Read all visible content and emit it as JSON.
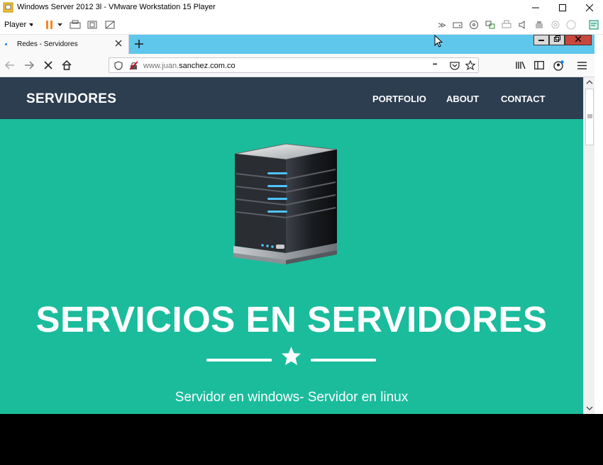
{
  "vm": {
    "window_title": "Windows Server 2012 3l - VMware Workstation 15 Player",
    "player_menu": "Player"
  },
  "browser": {
    "tab_title": "Redes - Servidores",
    "url_prefix": "www.juan.",
    "url_domain": "sanchez.com.co",
    "menu_dots": "•••"
  },
  "site": {
    "brand": "SERVIDORES",
    "nav_links": [
      "PORTFOLIO",
      "ABOUT",
      "CONTACT"
    ],
    "hero_title": "SERVICIOS EN SERVIDORES",
    "hero_subtitle": "Servidor en windows- Servidor en linux"
  },
  "colors": {
    "navbar_bg": "#2c3e50",
    "hero_bg": "#1abc9c",
    "tabstrip_bg": "#5fc6ec",
    "pause_orange": "#f08a24"
  }
}
